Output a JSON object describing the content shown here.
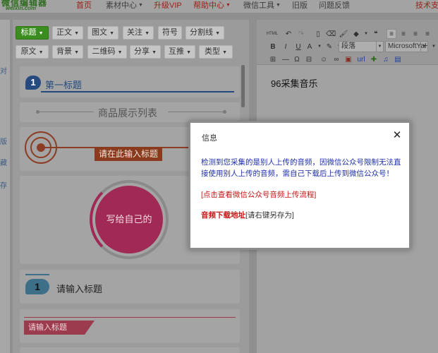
{
  "logo": {
    "cn": "微信编辑器",
    "en": "weixin.com"
  },
  "nav": [
    {
      "label": "首页",
      "red": true,
      "caret": false
    },
    {
      "label": "素材中心",
      "red": false,
      "caret": true
    },
    {
      "label": "升级VIP",
      "red": true,
      "caret": false
    },
    {
      "label": "帮助中心",
      "red": true,
      "caret": true
    },
    {
      "label": "微信工具",
      "red": false,
      "caret": true
    },
    {
      "label": "旧版",
      "red": false,
      "caret": false
    },
    {
      "label": "问题反馈",
      "red": false,
      "caret": false
    },
    {
      "label": "技术支",
      "red": true,
      "caret": false
    }
  ],
  "left_strip": [
    "对",
    "版",
    "藏",
    "存"
  ],
  "style_tabs": {
    "row1": [
      "标题",
      "正文",
      "图文",
      "关注",
      "符号",
      "分割线"
    ],
    "row2": [
      "原文",
      "背景",
      "二维码",
      "分享",
      "互推",
      "类型"
    ]
  },
  "samples": {
    "first_title_num": "1",
    "first_title": "第一标题",
    "product_list": "商品展示列表",
    "input_title_tag": "请在此输入标题",
    "circle_text": "写给自己的",
    "numbered_num": "1",
    "numbered_title": "请输入标题",
    "ribbon_title": "请输入标题"
  },
  "toolbar": {
    "html_label": "HTML",
    "paragraph_select": "段落",
    "font_select": "MicrosoftYaHei",
    "url_label": "url"
  },
  "editor": {
    "content": "96采集音乐"
  },
  "modal": {
    "title": "信息",
    "close": "✕",
    "message": "检测到您采集的是别人上传的音频，因微信公众号限制无法直接使用别人上传的音频，需自己下载后上传到微信公众号！",
    "link_text": "[点击查看微信公众号音频上传流程]",
    "download_label": "音频下载地址",
    "download_hint": "[请右键另存为]"
  },
  "colors": {
    "accent_green": "#3a8d1e",
    "brand_red": "#c41515",
    "link_blue": "#1f2fa8"
  }
}
